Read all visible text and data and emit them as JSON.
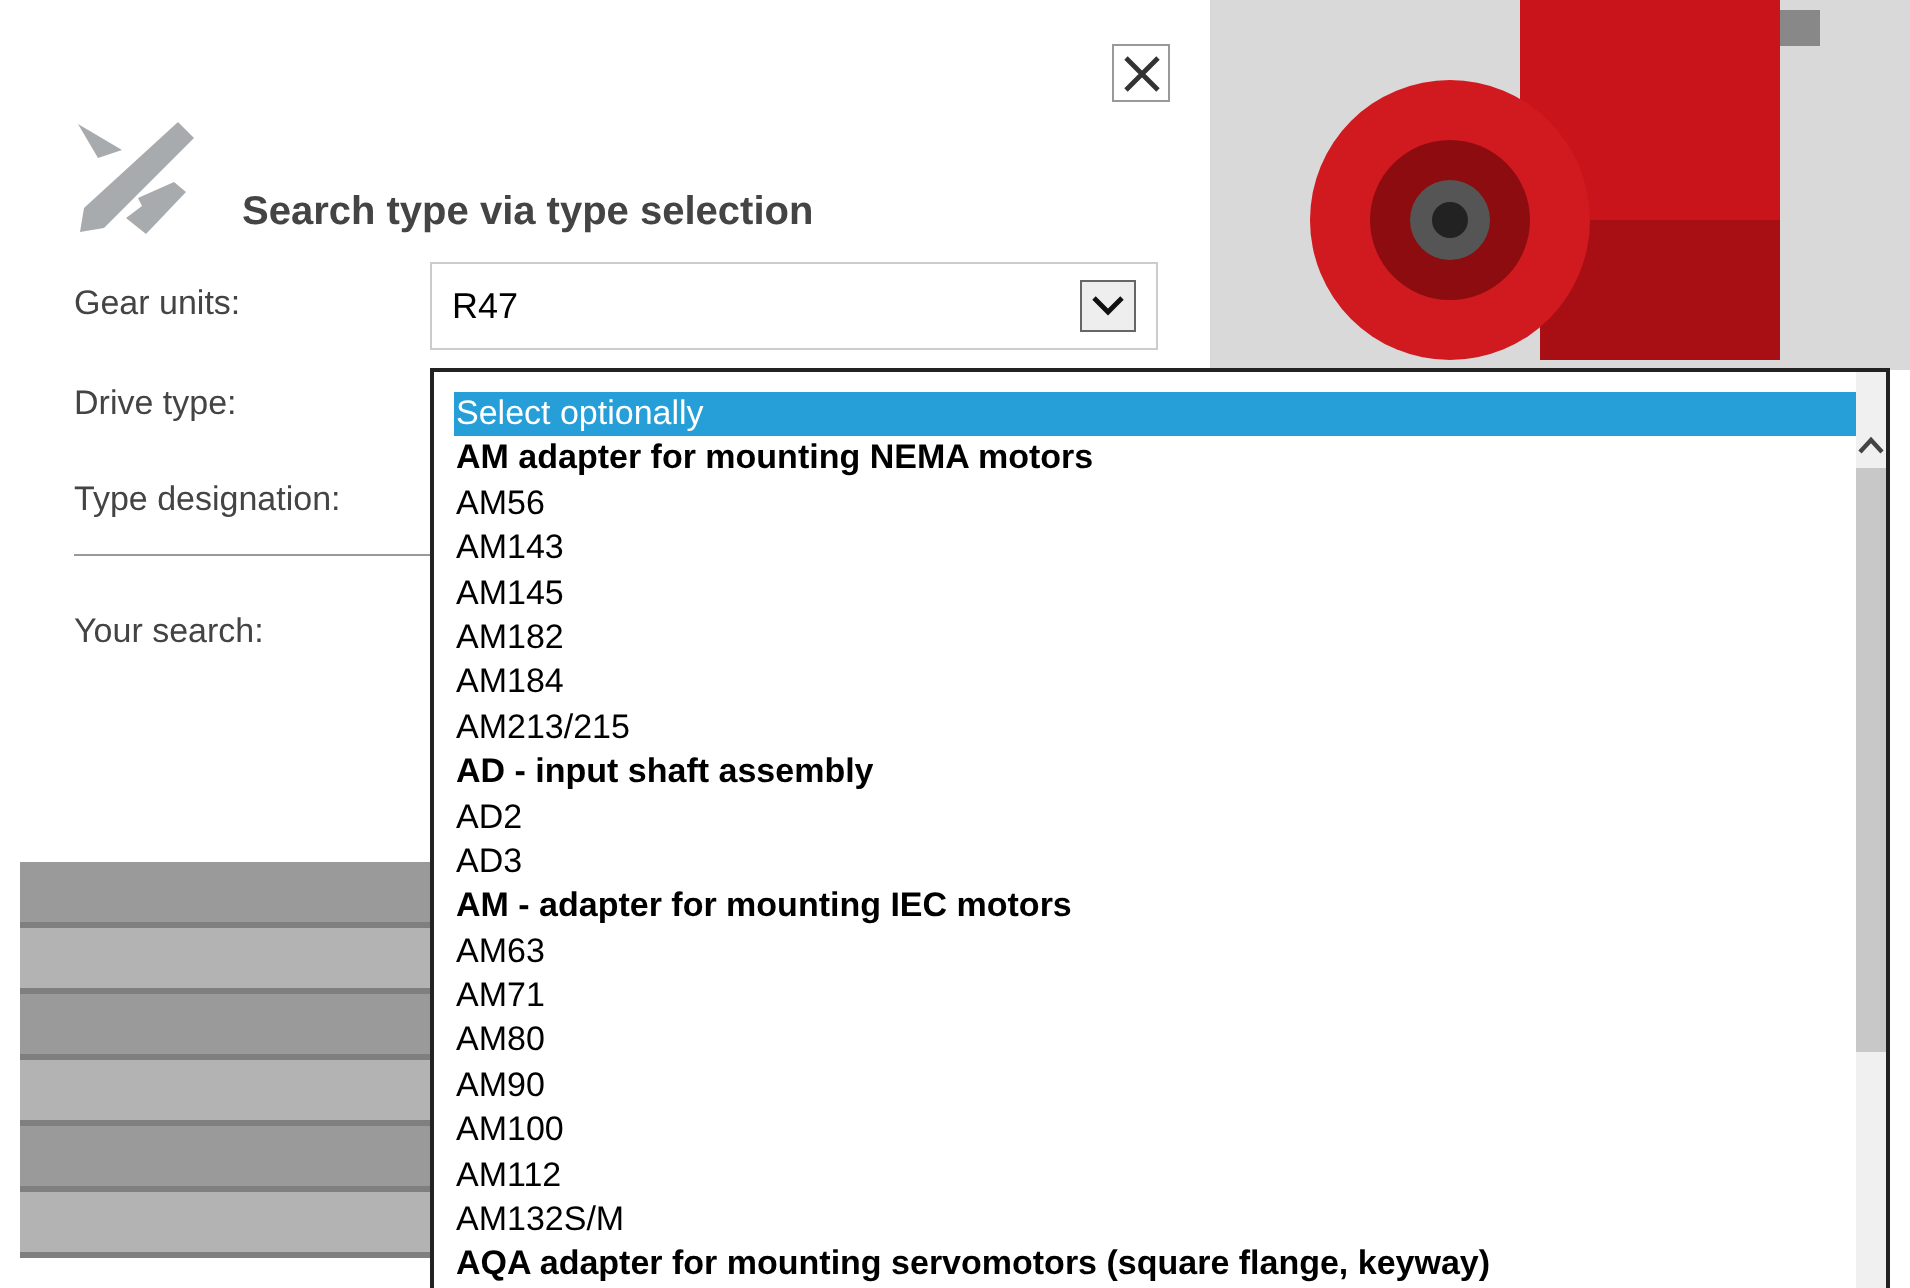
{
  "dialog": {
    "title": "Search type via type selection"
  },
  "fields": [
    {
      "label": "Gear units:",
      "value": "R47"
    },
    {
      "label": "Drive type:"
    },
    {
      "label": "Type designation:"
    }
  ],
  "your_search": {
    "label": "Your search:"
  },
  "dropdown": {
    "options": [
      {
        "kind": "item",
        "text": "Select optionally",
        "selected": true
      },
      {
        "kind": "heading",
        "text": "AM adapter for mounting NEMA motors",
        "selected": false
      },
      {
        "kind": "item",
        "text": "AM56",
        "selected": false
      },
      {
        "kind": "item",
        "text": "AM143",
        "selected": false
      },
      {
        "kind": "item",
        "text": "AM145",
        "selected": false
      },
      {
        "kind": "item",
        "text": "AM182",
        "selected": false
      },
      {
        "kind": "item",
        "text": "AM184",
        "selected": false
      },
      {
        "kind": "item",
        "text": "AM213/215",
        "selected": false
      },
      {
        "kind": "heading",
        "text": "AD - input shaft assembly",
        "selected": false
      },
      {
        "kind": "item",
        "text": "AD2",
        "selected": false
      },
      {
        "kind": "item",
        "text": "AD3",
        "selected": false
      },
      {
        "kind": "heading",
        "text": "AM - adapter for mounting IEC motors",
        "selected": false
      },
      {
        "kind": "item",
        "text": "AM63",
        "selected": false
      },
      {
        "kind": "item",
        "text": "AM71",
        "selected": false
      },
      {
        "kind": "item",
        "text": "AM80",
        "selected": false
      },
      {
        "kind": "item",
        "text": "AM90",
        "selected": false
      },
      {
        "kind": "item",
        "text": "AM100",
        "selected": false
      },
      {
        "kind": "item",
        "text": "AM112",
        "selected": false
      },
      {
        "kind": "item",
        "text": "AM132S/M",
        "selected": false
      },
      {
        "kind": "heading",
        "text": "AQA adapter for mounting servomotors (square flange, keyway)",
        "selected": false
      }
    ]
  }
}
